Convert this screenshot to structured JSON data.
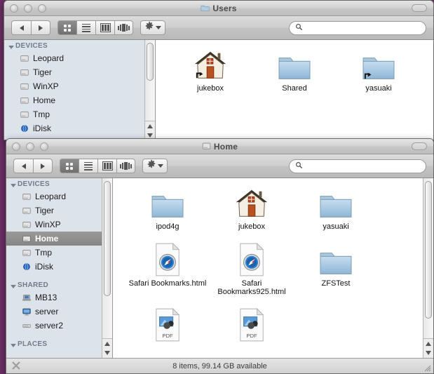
{
  "desktop": {
    "background_color": "#6b2f63"
  },
  "windows": [
    {
      "id": "users-window",
      "title": "Users",
      "title_icon": "folder-icon",
      "active": false,
      "traffic_lights": [
        "close-button",
        "minimize-button",
        "zoom-button"
      ],
      "toolbar": {
        "back_label": "Back",
        "forward_label": "Forward",
        "views": [
          {
            "name": "icon-view",
            "label": "Icon View",
            "selected": true
          },
          {
            "name": "list-view",
            "label": "List View",
            "selected": false
          },
          {
            "name": "column-view",
            "label": "Column View",
            "selected": false
          },
          {
            "name": "coverflow-view",
            "label": "Cover Flow View",
            "selected": false
          }
        ],
        "action_label": "Action",
        "search_placeholder": "",
        "search_value": ""
      },
      "sidebar": {
        "sections": [
          {
            "header": "DEVICES",
            "items": [
              {
                "label": "Leopard",
                "icon": "hard-drive-icon",
                "selected": false
              },
              {
                "label": "Tiger",
                "icon": "hard-drive-icon",
                "selected": false
              },
              {
                "label": "WinXP",
                "icon": "hard-drive-icon",
                "selected": false
              },
              {
                "label": "Home",
                "icon": "hard-drive-icon",
                "selected": false
              },
              {
                "label": "Tmp",
                "icon": "hard-drive-icon",
                "selected": false
              },
              {
                "label": "iDisk",
                "icon": "idisk-icon",
                "selected": false
              }
            ]
          }
        ]
      },
      "files": [
        {
          "label": "jukebox",
          "icon": "house-alias-icon"
        },
        {
          "label": "Shared",
          "icon": "folder-icon"
        },
        {
          "label": "yasuaki",
          "icon": "folder-alias-icon"
        }
      ]
    },
    {
      "id": "home-window",
      "title": "Home",
      "title_icon": "hard-drive-icon",
      "active": false,
      "traffic_lights": [
        "close-button",
        "minimize-button",
        "zoom-button"
      ],
      "toolbar": {
        "back_label": "Back",
        "forward_label": "Forward",
        "views": [
          {
            "name": "icon-view",
            "label": "Icon View",
            "selected": true
          },
          {
            "name": "list-view",
            "label": "List View",
            "selected": false
          },
          {
            "name": "column-view",
            "label": "Column View",
            "selected": false
          },
          {
            "name": "coverflow-view",
            "label": "Cover Flow View",
            "selected": false
          }
        ],
        "action_label": "Action",
        "search_placeholder": "",
        "search_value": ""
      },
      "sidebar": {
        "sections": [
          {
            "header": "DEVICES",
            "items": [
              {
                "label": "Leopard",
                "icon": "hard-drive-icon",
                "selected": false
              },
              {
                "label": "Tiger",
                "icon": "hard-drive-icon",
                "selected": false
              },
              {
                "label": "WinXP",
                "icon": "hard-drive-icon",
                "selected": false
              },
              {
                "label": "Home",
                "icon": "hard-drive-icon",
                "selected": true
              },
              {
                "label": "Tmp",
                "icon": "hard-drive-icon",
                "selected": false
              },
              {
                "label": "iDisk",
                "icon": "idisk-icon",
                "selected": false
              }
            ]
          },
          {
            "header": "SHARED",
            "items": [
              {
                "label": "MB13",
                "icon": "laptop-icon",
                "selected": false
              },
              {
                "label": "server",
                "icon": "display-icon",
                "selected": false
              },
              {
                "label": "server2",
                "icon": "generic-server-icon",
                "selected": false
              }
            ]
          },
          {
            "header": "PLACES",
            "items": []
          }
        ]
      },
      "files": [
        {
          "label": "ipod4g",
          "icon": "folder-icon"
        },
        {
          "label": "jukebox",
          "icon": "house-icon"
        },
        {
          "label": "yasuaki",
          "icon": "folder-icon"
        },
        {
          "label": "Safari Bookmarks.html",
          "icon": "safari-document-icon"
        },
        {
          "label": "Safari Bookmarks925.html",
          "icon": "safari-document-icon"
        },
        {
          "label": "ZFSTest",
          "icon": "folder-icon"
        },
        {
          "label": "",
          "icon": "pdf-document-icon"
        },
        {
          "label": "",
          "icon": "pdf-document-icon"
        }
      ],
      "statusbar": {
        "text": "8 items, 99.14 GB available",
        "eject_icon": "eject-icon",
        "resize_icon": "resize-grip-icon"
      }
    }
  ]
}
